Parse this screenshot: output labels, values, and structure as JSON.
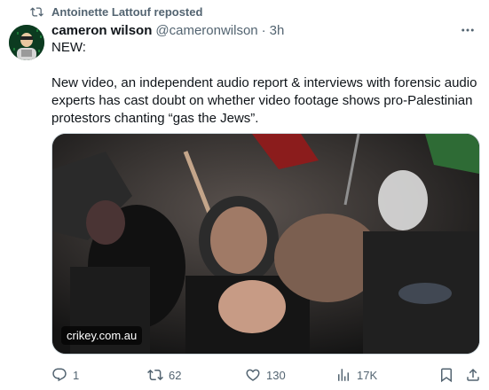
{
  "repost": {
    "text": "Antoinette Lattouf reposted",
    "icon": "repost-icon"
  },
  "author": {
    "display_name": "cameron wilson",
    "handle": "@cameronwilson",
    "separator": "·",
    "time": "3h"
  },
  "tweet": {
    "line1": "NEW:",
    "line2": "New video, an independent audio report & interviews with forensic audio experts has cast doubt on whether video footage shows pro-Palestinian protestors chanting “gas the Jews”."
  },
  "media": {
    "source_label": "crikey.com.au"
  },
  "actions": {
    "reply_count": "1",
    "repost_count": "62",
    "like_count": "130",
    "view_count": "17K"
  },
  "colors": {
    "text_primary": "#0f1419",
    "text_secondary": "#536471",
    "border": "#cfd9de"
  }
}
